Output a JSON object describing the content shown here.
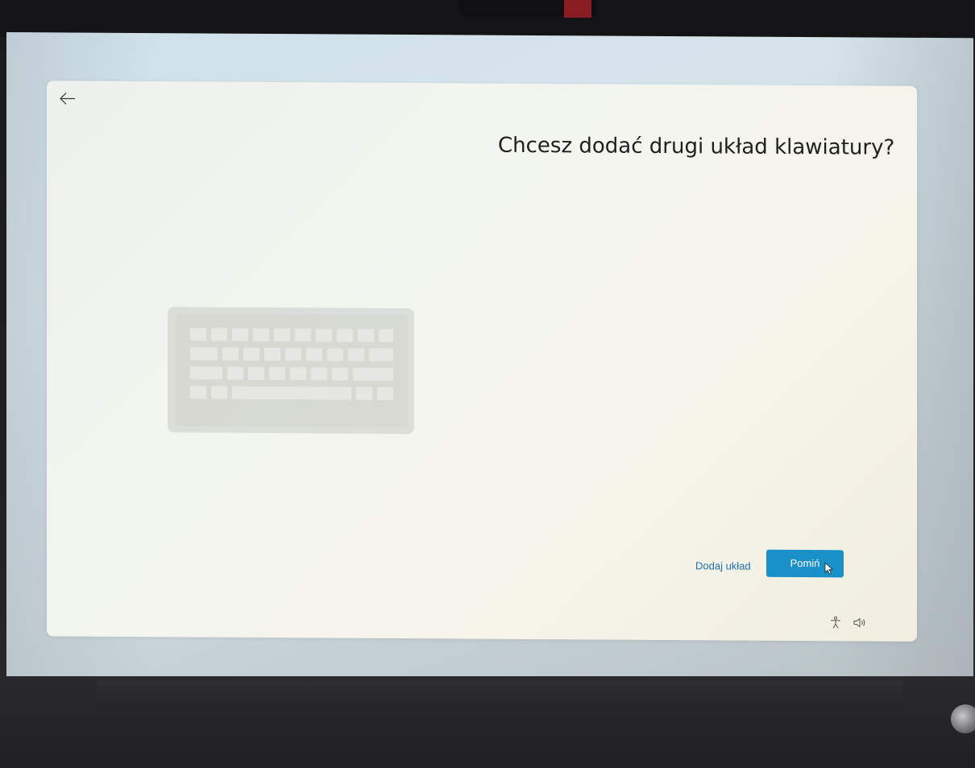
{
  "dialog": {
    "title": "Chcesz dodać drugi układ klawiatury?",
    "back_icon": "arrow-left-icon",
    "illustration_icon": "keyboard-icon"
  },
  "actions": {
    "add_label": "Dodaj układ",
    "skip_label": "Pomiń"
  },
  "footer_icons": {
    "accessibility_icon": "accessibility-icon",
    "volume_icon": "speaker-volume-icon"
  },
  "colors": {
    "accent": "#1a90c9",
    "link": "#1f6fb0",
    "title_text": "#1f1f1f"
  }
}
